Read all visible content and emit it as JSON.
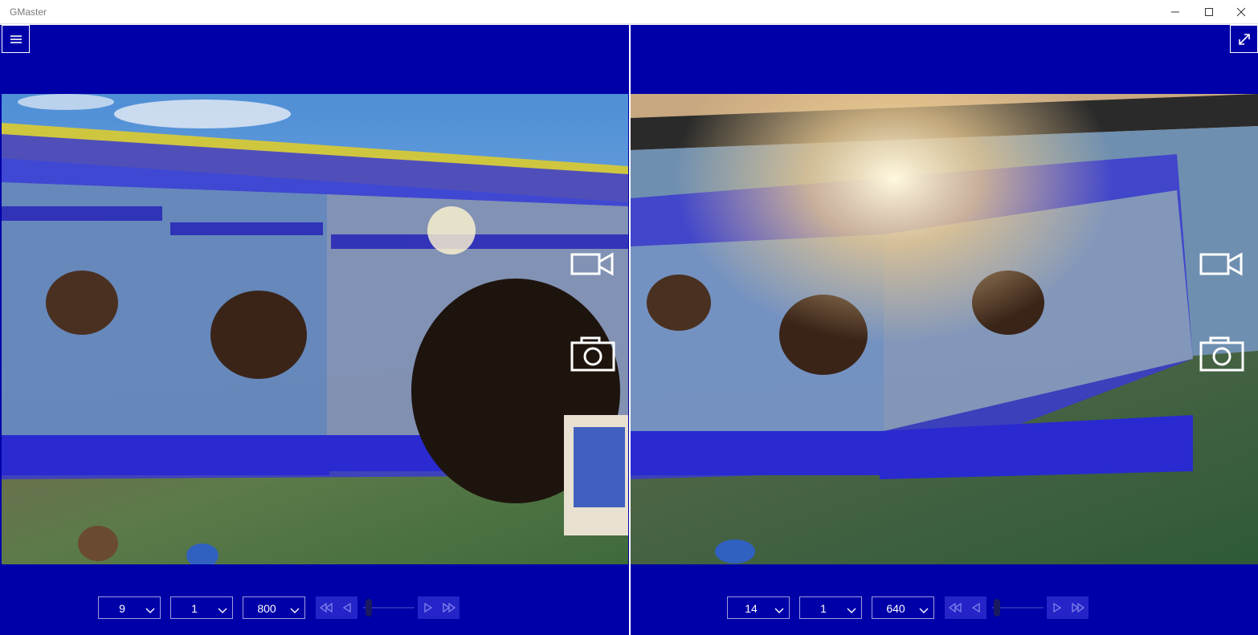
{
  "window": {
    "title": "GMaster"
  },
  "left": {
    "iso": "9",
    "aperture": "1",
    "shutter": "800"
  },
  "right": {
    "iso": "14",
    "aperture": "1",
    "shutter": "640"
  },
  "colors": {
    "background": "#0000a8",
    "accent": "#ffffff",
    "button": "#2424c8"
  },
  "icons": [
    "hamburger-menu-icon",
    "expand-icon",
    "video-camera-icon",
    "camera-icon",
    "chevron-down-icon",
    "skip-back-icon",
    "step-back-icon",
    "step-forward-icon",
    "skip-forward-icon"
  ]
}
